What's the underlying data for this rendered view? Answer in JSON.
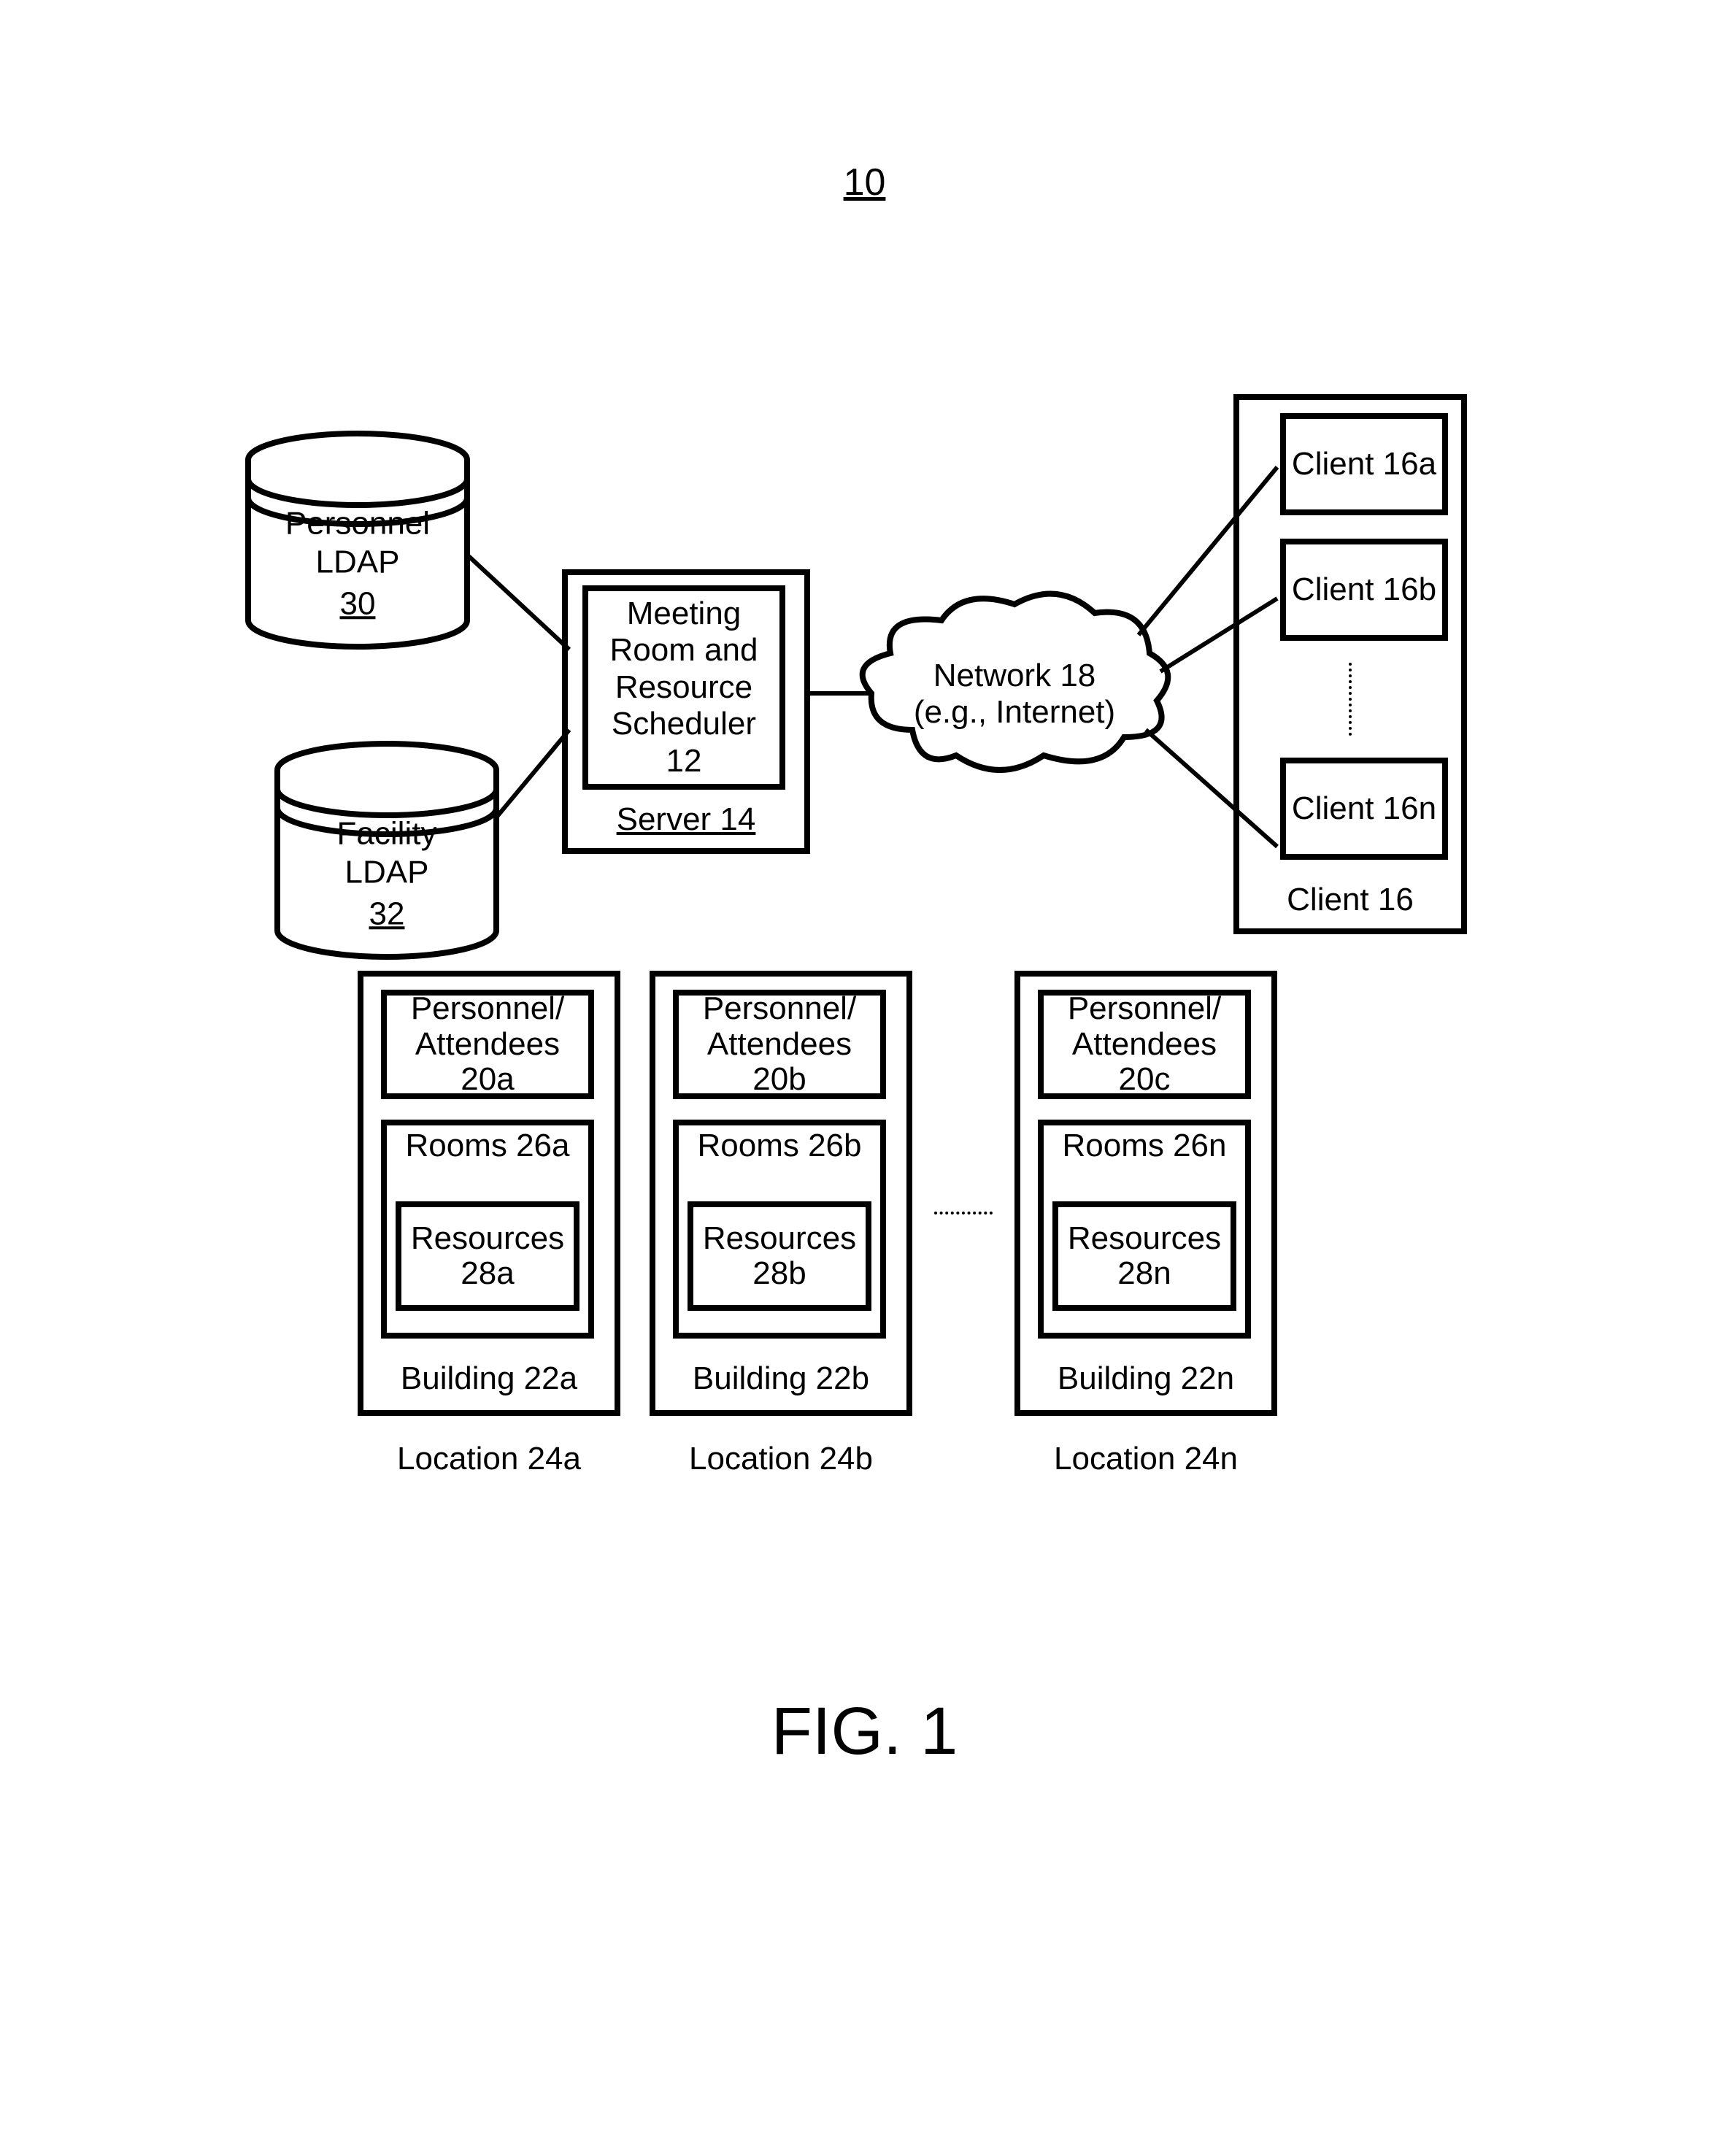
{
  "figure": {
    "number": "10",
    "caption": "FIG. 1"
  },
  "databases": {
    "personnel": {
      "line1": "Personnel",
      "line2": "LDAP",
      "ref": "30"
    },
    "facility": {
      "line1": "Facility",
      "line2": "LDAP",
      "ref": "32"
    }
  },
  "server": {
    "inner": "Meeting Room and Resource Scheduler 12",
    "label": "Server 14"
  },
  "network": {
    "line1": "Network 18",
    "line2": "(e.g., Internet)"
  },
  "clients": {
    "container_label": "Client 16",
    "a": "Client 16a",
    "b": "Client 16b",
    "n": "Client 16n"
  },
  "buildings": {
    "a": {
      "personnel": "Personnel/ Attendees 20a",
      "rooms": "Rooms 26a",
      "resources": "Resources 28a",
      "building": "Building 22a",
      "location": "Location 24a"
    },
    "b": {
      "personnel": "Personnel/ Attendees 20b",
      "rooms": "Rooms 26b",
      "resources": "Resources 28b",
      "building": "Building 22b",
      "location": "Location 24b"
    },
    "n": {
      "personnel": "Personnel/ Attendees 20c",
      "rooms": "Rooms 26n",
      "resources": "Resources 28n",
      "building": "Building 22n",
      "location": "Location 24n"
    }
  }
}
